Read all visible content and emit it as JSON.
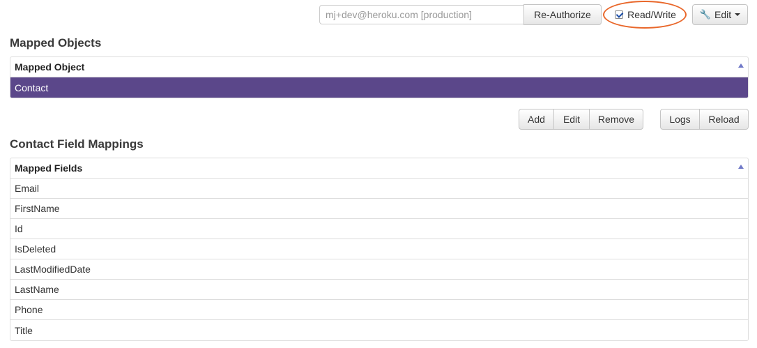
{
  "toolbar": {
    "auth_account": "mj+dev@heroku.com [production]",
    "reauthorize_label": "Re-Authorize",
    "readwrite_label": "Read/Write",
    "readwrite_checked": true,
    "edit_label": "Edit",
    "highlight_color": "#e9672a"
  },
  "mapped_objects": {
    "heading": "Mapped Objects",
    "column_header": "Mapped Object",
    "rows": [
      "Contact"
    ],
    "selected_row": "Contact",
    "selected_color": "#5b478a"
  },
  "actions": {
    "add_label": "Add",
    "edit_label": "Edit",
    "remove_label": "Remove",
    "logs_label": "Logs",
    "reload_label": "Reload"
  },
  "field_mappings": {
    "heading": "Contact Field Mappings",
    "column_header": "Mapped Fields",
    "rows": [
      "Email",
      "FirstName",
      "Id",
      "IsDeleted",
      "LastModifiedDate",
      "LastName",
      "Phone",
      "Title"
    ]
  }
}
